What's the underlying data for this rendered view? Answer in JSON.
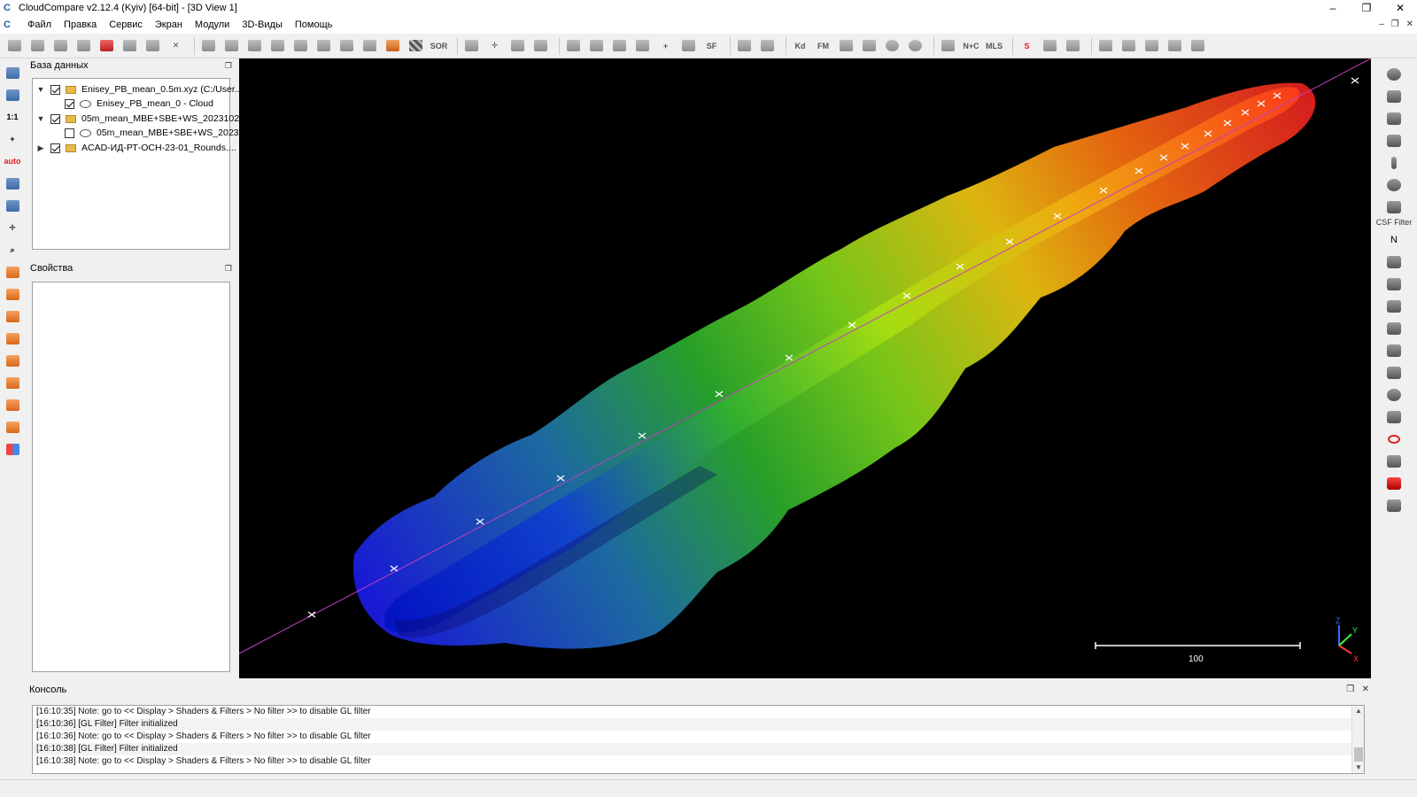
{
  "window": {
    "title": "CloudCompare v2.12.4 (Kyiv) [64-bit] - [3D View 1]",
    "controls": {
      "minimize": "–",
      "restore": "❐",
      "close": "✕"
    }
  },
  "menu": {
    "items": [
      "Файл",
      "Правка",
      "Сервис",
      "Экран",
      "Модули",
      "3D-Виды",
      "Помощь"
    ],
    "mdi_controls": {
      "minimize": "–",
      "restore": "❐",
      "close": "✕"
    }
  },
  "toolbar": {
    "sor_label": "SOR",
    "sf_label": "SF",
    "kd_label": "Kd",
    "fm_label": "FM",
    "nc_label": "N+C",
    "mls_label": "MLS"
  },
  "left_toolbar": {
    "one_to_one": "1:1",
    "auto": "auto",
    "front": "FRONT",
    "back": "BACK"
  },
  "right_toolbar": {
    "csf_label": "CSF Filter",
    "n_label": "N"
  },
  "db_panel": {
    "title": "База данных",
    "items": [
      {
        "label": "Enisey_PB_mean_0.5m.xyz (C:/User...",
        "checked": true
      },
      {
        "label": "Enisey_PB_mean_0 - Cloud",
        "checked": true
      },
      {
        "label": "05m_mean_MBE+SBE+WS_2023102...",
        "checked": true
      },
      {
        "label": "05m_mean_MBE+SBE+WS_2023...",
        "checked": false
      },
      {
        "label": "ACAD-ИД-РТ-ОСН-23-01_Rounds....",
        "checked": true
      }
    ]
  },
  "props_panel": {
    "title": "Свойства"
  },
  "view3d": {
    "scale_label": "100",
    "axes": {
      "z": "Z",
      "y": "Y",
      "x": "X"
    },
    "colors": {
      "background": "#000000",
      "track_line": "#c040c0",
      "marker": "#ffffff"
    }
  },
  "console": {
    "title": "Консоль",
    "lines": [
      "[16:10:35] Note: go to << Display > Shaders & Filters > No filter >> to disable GL filter",
      "[16:10:36] [GL Filter] Filter initialized",
      "[16:10:36] Note: go to << Display > Shaders & Filters > No filter >> to disable GL filter",
      "[16:10:38] [GL Filter] Filter initialized",
      "[16:10:38] Note: go to << Display > Shaders & Filters > No filter >> to disable GL filter"
    ]
  }
}
